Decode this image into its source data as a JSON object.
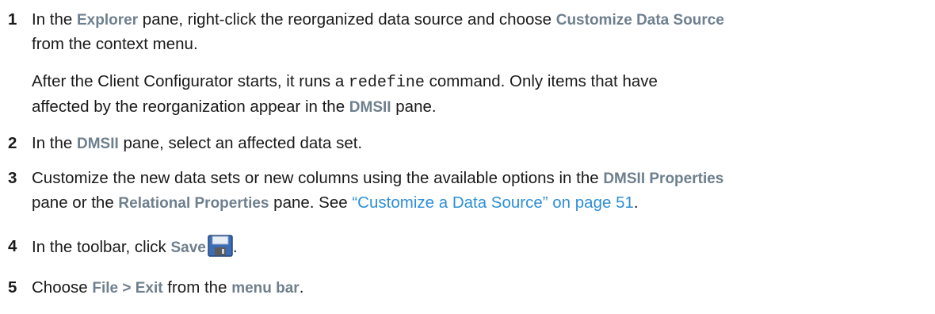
{
  "steps": [
    {
      "number": "1",
      "t1": "In the ",
      "ui1": "Explorer",
      "t2": " pane, right-click the reorganized data source and choose ",
      "ui2": "Customize Data Source",
      "t3": "from the context menu.",
      "note": {
        "t1": "After the Client Configurator starts, it runs a ",
        "code": "redefine",
        "t2": " command. Only items that have",
        "t3": "affected by the reorganization appear in the ",
        "ui": "DMSII",
        "t4": " pane."
      }
    },
    {
      "number": "2",
      "t1": "In the ",
      "ui1": "DMSII",
      "t2": " pane, select an affected data set."
    },
    {
      "number": "3",
      "t1": "Customize the new data sets or new columns using the available options in the ",
      "ui1": "DMSII Properties",
      "t2": "pane or the ",
      "ui2": "Relational Properties",
      "t3": " pane. See ",
      "link": "“Customize a Data Source” on page 51",
      "t4": "."
    },
    {
      "number": "4",
      "t1": "In the toolbar, click ",
      "ui1": "Save",
      "icon": "save-floppy-icon",
      "t2": "."
    },
    {
      "number": "5",
      "t1": "Choose ",
      "ui1": "File > Exit",
      "t2": " from the ",
      "ui2": "menu bar",
      "t3": "."
    }
  ],
  "colors": {
    "ui_term": "#6e7f8d",
    "link": "#2f8fd6",
    "text": "#1a1a1a"
  }
}
